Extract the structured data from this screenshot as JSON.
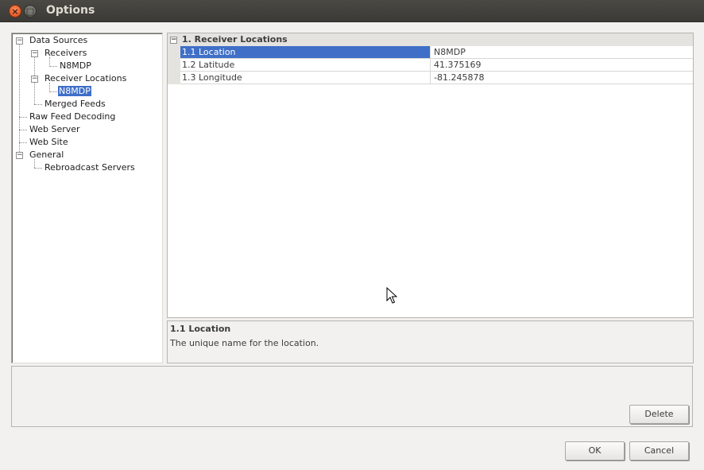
{
  "window": {
    "title": "Options",
    "close_glyph": "×",
    "maximize_glyph": "□"
  },
  "tree": {
    "nodes": [
      {
        "label": "Data Sources",
        "expander": "−"
      },
      {
        "label": "Receivers",
        "expander": "−"
      },
      {
        "label": "N8MDP"
      },
      {
        "label": "Receiver Locations",
        "expander": "−"
      },
      {
        "label": "N8MDP",
        "selected": true
      },
      {
        "label": "Merged Feeds"
      },
      {
        "label": "Raw Feed Decoding"
      },
      {
        "label": "Web Server"
      },
      {
        "label": "Web Site"
      },
      {
        "label": "General",
        "expander": "−"
      },
      {
        "label": "Rebroadcast Servers"
      }
    ]
  },
  "grid": {
    "category": "1. Receiver Locations",
    "category_expander": "−",
    "rows": [
      {
        "name": "1.1 Location",
        "value": "N8MDP",
        "selected": true
      },
      {
        "name": "1.2 Latitude",
        "value": "41.375169"
      },
      {
        "name": "1.3 Longitude",
        "value": "-81.245878"
      }
    ]
  },
  "description": {
    "title": "1.1 Location",
    "text": "The unique name for the location."
  },
  "buttons": {
    "delete": "Delete",
    "ok": "OK",
    "cancel": "Cancel"
  },
  "colors": {
    "selection": "#3f6fc7",
    "close_button": "#df4b16",
    "titlebar": "#3b3a36"
  }
}
